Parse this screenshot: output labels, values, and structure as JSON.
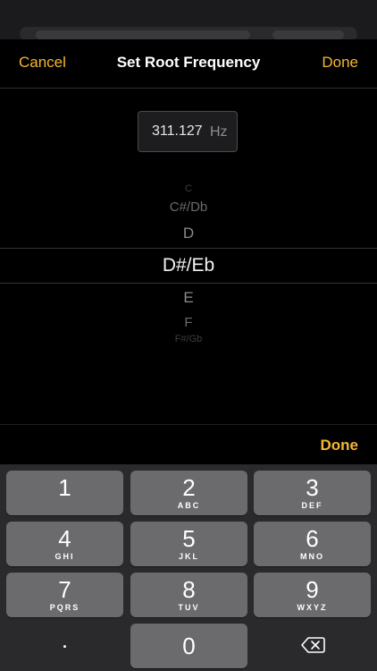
{
  "nav": {
    "cancel_label": "Cancel",
    "title": "Set Root Frequency",
    "done_label": "Done"
  },
  "frequency": {
    "value": "311.127",
    "unit": "Hz"
  },
  "picker": {
    "items": [
      "C",
      "C#/Db",
      "D",
      "D#/Eb",
      "E",
      "F",
      "F#/Gb"
    ],
    "selected": "D#/Eb"
  },
  "accessory": {
    "done_label": "Done"
  },
  "keypad": {
    "keys": [
      {
        "num": "1",
        "letters": ""
      },
      {
        "num": "2",
        "letters": "ABC"
      },
      {
        "num": "3",
        "letters": "DEF"
      },
      {
        "num": "4",
        "letters": "GHI"
      },
      {
        "num": "5",
        "letters": "JKL"
      },
      {
        "num": "6",
        "letters": "MNO"
      },
      {
        "num": "7",
        "letters": "PQRS"
      },
      {
        "num": "8",
        "letters": "TUV"
      },
      {
        "num": "9",
        "letters": "WXYZ"
      }
    ],
    "decimal": ".",
    "zero": "0",
    "delete_icon": "delete-backward-icon"
  },
  "colors": {
    "accent": "#f5b731",
    "background": "#000000",
    "key": "#6b6b6e",
    "keyboard": "#2a2a2c"
  }
}
